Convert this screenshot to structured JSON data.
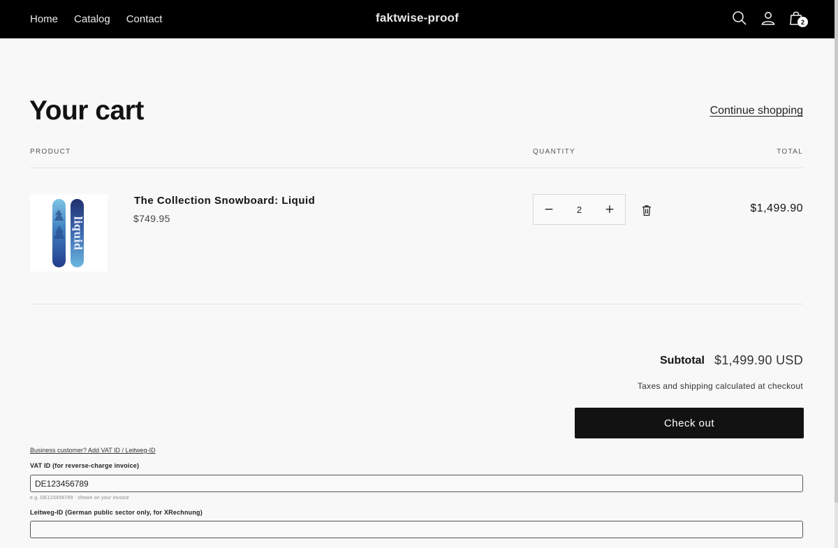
{
  "header": {
    "nav": [
      "Home",
      "Catalog",
      "Contact"
    ],
    "brand": "faktwise-proof",
    "cart_count": "2",
    "icons": {
      "search": "search-icon",
      "account": "account-icon",
      "cart": "cart-icon"
    },
    "background": "#000000"
  },
  "cart": {
    "title": "Your cart",
    "continue_label": "Continue shopping",
    "columns": {
      "product": "PRODUCT",
      "quantity": "QUANTITY",
      "total": "TOTAL"
    },
    "items": [
      {
        "name": "The Collection Snowboard: Liquid",
        "price": "$749.95",
        "quantity": "2",
        "total": "$1,499.90",
        "image_icon": "snowboard-image"
      }
    ],
    "decrease_symbol": "−",
    "increase_symbol": "+"
  },
  "summary": {
    "subtotal_label": "Subtotal",
    "subtotal_value": "$1,499.90 USD",
    "tax_note": "Taxes and shipping calculated at checkout",
    "checkout_label": "Check out",
    "checkout_color": "#121212"
  },
  "business": {
    "toggle_link": "Business customer? Add VAT ID / Leitweg-ID",
    "vat_label": "VAT ID (for reverse-charge invoice)",
    "vat_value": "DE123456789",
    "vat_hint": "e.g. DE123456789 · shown on your invoice",
    "leitweg_label": "Leitweg-ID (German public sector only, for XRechnung)",
    "leitweg_value": ""
  }
}
